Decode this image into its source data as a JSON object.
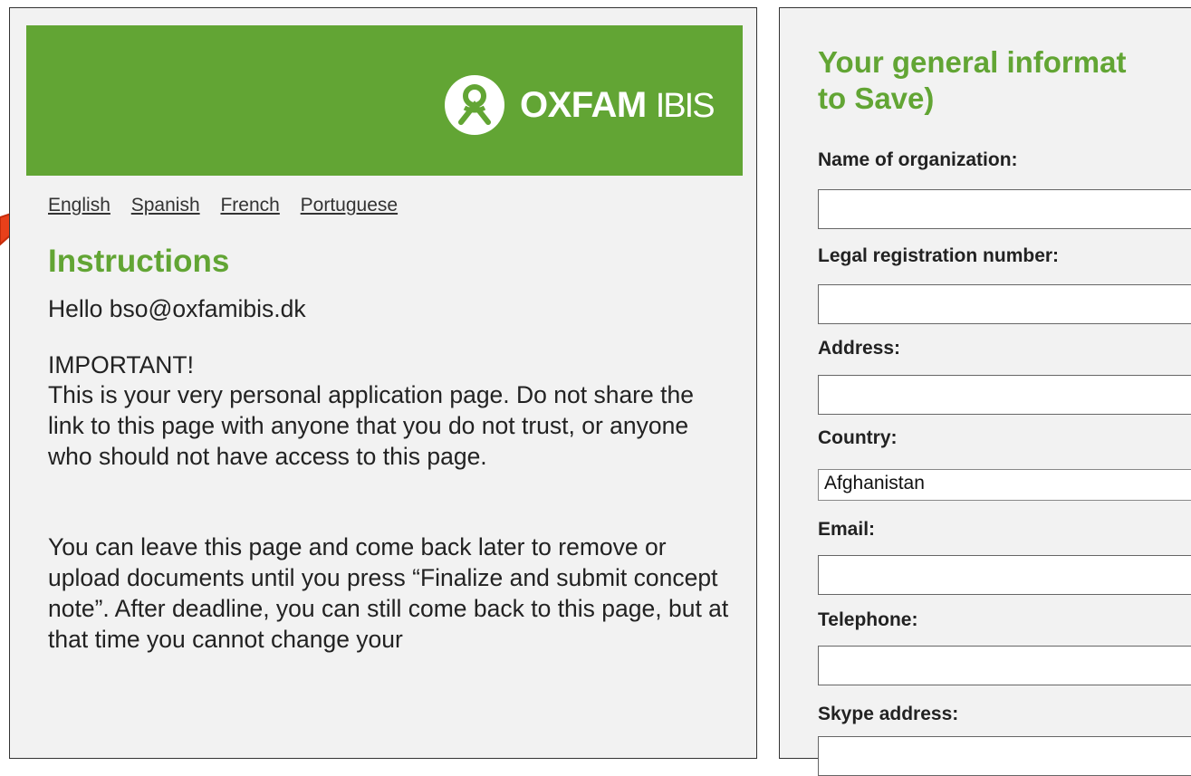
{
  "logo": {
    "name": "OXFAM",
    "sub": "IBIS"
  },
  "languages": [
    "English",
    "Spanish",
    "French",
    "Portuguese"
  ],
  "instructions": {
    "title": "Instructions",
    "greeting": "Hello bso@oxfamibis.dk",
    "important_heading": "IMPORTANT!",
    "important_text": "This is your very personal application page. Do not share the link to this page with anyone that you do not trust, or anyone who should not have access to this page.",
    "info_text": "You can leave this page and come back later to remove or upload documents until you press “Finalize and submit concept note”. After deadline, you can still come back to this page, but at that time you cannot change your"
  },
  "form": {
    "title_line1": "Your general informat",
    "title_line2": "to Save)",
    "fields": {
      "org_name": {
        "label": "Name of organization:",
        "value": ""
      },
      "legal_reg": {
        "label": "Legal registration number:",
        "value": ""
      },
      "address": {
        "label": "Address:",
        "value": ""
      },
      "country": {
        "label": "Country:",
        "value": "Afghanistan"
      },
      "email": {
        "label": "Email:",
        "value": ""
      },
      "telephone": {
        "label": "Telephone:",
        "value": ""
      },
      "skype": {
        "label": "Skype address:",
        "value": ""
      }
    }
  },
  "colors": {
    "brand_green": "#62a534",
    "arrow": "#e8401a",
    "panel_bg": "#f2f2f2"
  }
}
